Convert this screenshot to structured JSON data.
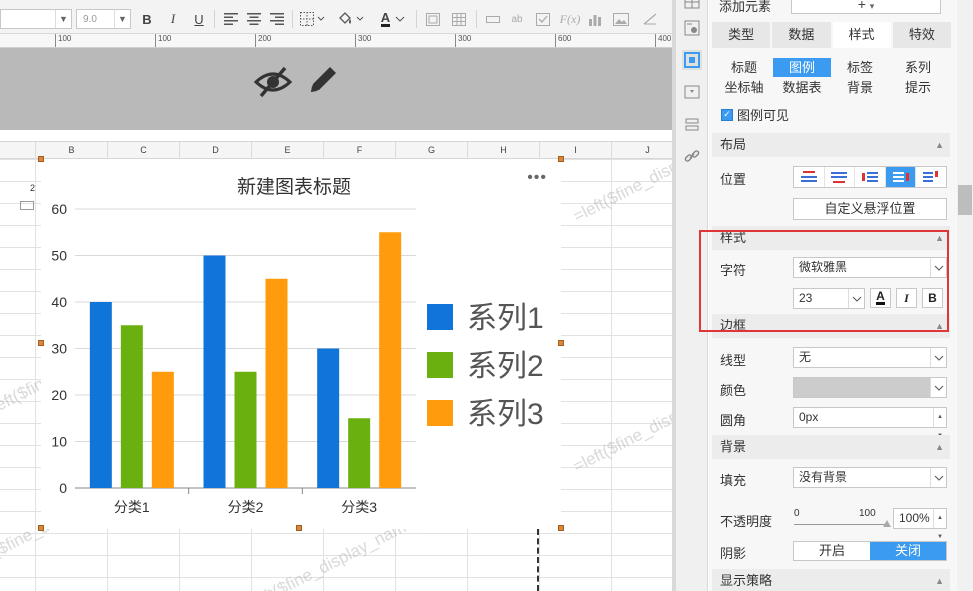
{
  "toolbar": {
    "font_size_value": "9.0",
    "bold_label": "B",
    "italic_label": "I",
    "underline_label": "U",
    "font_color_label": "A"
  },
  "ruler": {
    "ticks": [
      "100",
      "200",
      "300",
      "400",
      "500",
      "600",
      "700"
    ]
  },
  "columns": [
    "B",
    "C",
    "D",
    "E",
    "F",
    "G",
    "H",
    "I",
    "J"
  ],
  "sheet": {
    "cell_fragment": "2",
    "watermark_text": "=left($fine_display_name)-1)"
  },
  "chart_data": {
    "type": "bar",
    "title": "新建图表标题",
    "more_label": "•••",
    "categories": [
      "分类1",
      "分类2",
      "分类3"
    ],
    "series": [
      {
        "name": "系列1",
        "color": "#1075d8",
        "values": [
          40,
          50,
          30
        ]
      },
      {
        "name": "系列2",
        "color": "#6ab10f",
        "values": [
          35,
          25,
          15
        ]
      },
      {
        "name": "系列3",
        "color": "#ff9b0d",
        "values": [
          25,
          45,
          55
        ]
      }
    ],
    "ylim": [
      0,
      60
    ],
    "yticks": [
      "0",
      "10",
      "20",
      "30",
      "40",
      "50",
      "60"
    ],
    "grid": true,
    "legend": "right"
  },
  "panel": {
    "add_element_label": "添加元素",
    "add_element_button": "+",
    "main_tabs": [
      "类型",
      "数据",
      "样式",
      "特效"
    ],
    "main_tab_active": "样式",
    "sub_tabs": [
      "标题",
      "图例",
      "标签",
      "系列",
      "坐标轴",
      "数据表",
      "背景",
      "提示"
    ],
    "sub_tab_active": "图例",
    "legend_visible_label": "图例可见",
    "layout_section": "布局",
    "position_label": "位置",
    "custom_float_button": "自定义悬浮位置",
    "style_section": "样式",
    "char_label": "字符",
    "font_family_value": "微软雅黑",
    "font_size_value": "23",
    "font_color_button": "A",
    "italic_button": "I",
    "bold_button": "B",
    "border_section": "边框",
    "line_type_label": "线型",
    "line_type_value": "无",
    "color_label": "颜色",
    "radius_label": "圆角",
    "radius_value": "0px",
    "background_section": "背景",
    "fill_label": "填充",
    "fill_value": "没有背景",
    "opacity_label": "不透明度",
    "opacity_min": "0",
    "opacity_max": "100",
    "opacity_value": "100%",
    "shadow_label": "阴影",
    "shadow_on": "开启",
    "shadow_off": "关闭",
    "display_strategy_section": "显示策略"
  },
  "colors": {
    "accent": "#3a9bf0",
    "highlight_box": "#e03636"
  }
}
